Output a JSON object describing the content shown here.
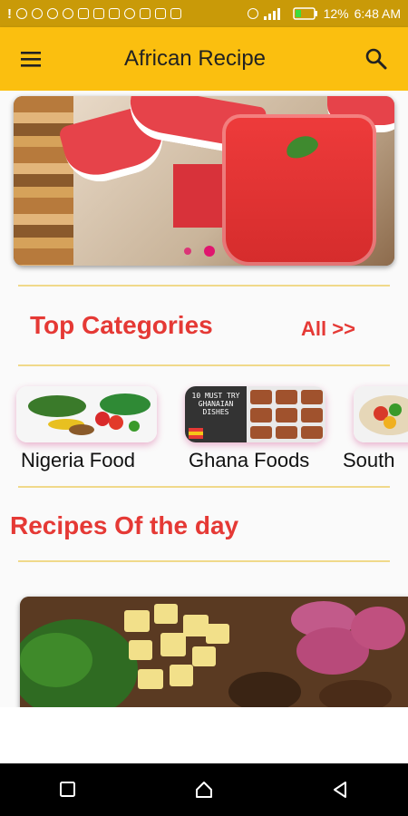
{
  "status_bar": {
    "battery_percent": "12%",
    "time": "6:48 AM",
    "icons": [
      "app-icon",
      "whatsapp-icon",
      "facebook-icon",
      "facebook-icon",
      "shirt-icon",
      "check-icon",
      "image-icon",
      "opera-icon",
      "gallery-icon",
      "twitter-icon",
      "message-icon",
      "wifi-icon",
      "signal-icon",
      "battery-icon"
    ]
  },
  "app_bar": {
    "title": "African Recipe",
    "menu_icon": "hamburger-menu-icon",
    "search_icon": "search-icon",
    "background": "#fbbf0f"
  },
  "banner": {
    "slides": 2,
    "active_slide": 2
  },
  "categories": {
    "title": "Top Categories",
    "all_link": "All >>",
    "items": [
      {
        "label": "Nigeria Food"
      },
      {
        "label": "Ghana Foods",
        "thumbnail_text": "10 MUST TRY GHANAIAN DISHES"
      },
      {
        "label": "South"
      }
    ]
  },
  "recipes_of_the_day": {
    "title": "Recipes Of the day"
  },
  "colors": {
    "accent_red": "#e53935",
    "divider": "#f0d98a",
    "status_bar": "#c99a08"
  },
  "nav_bar": {
    "buttons": [
      "recent-apps-icon",
      "home-icon",
      "back-icon"
    ]
  }
}
